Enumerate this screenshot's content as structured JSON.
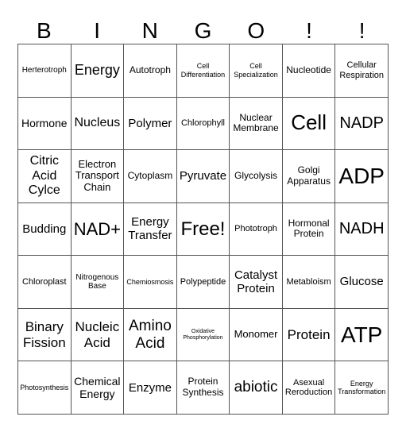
{
  "header": [
    "B",
    "I",
    "N",
    "G",
    "O",
    "!",
    "!"
  ],
  "rows": [
    [
      "Herterotroph",
      "Energy",
      "Autotroph",
      "Cell Differentiation",
      "Cell Specialization",
      "Nucleotide",
      "Cellular Respiration"
    ],
    [
      "Hormone",
      "Nucleus",
      "Polymer",
      "Chlorophyll",
      "Nuclear Membrane",
      "Cell",
      "NADP"
    ],
    [
      "Citric Acid Cylce",
      "Electron Transport Chain",
      "Cytoplasm",
      "Pyruvate",
      "Glycolysis",
      "Golgi Apparatus",
      "ADP"
    ],
    [
      "Budding",
      "NAD+",
      "Energy Transfer",
      "Free!",
      "Phototroph",
      "Hormonal Protein",
      "NADH"
    ],
    [
      "Chloroplast",
      "Nitrogenous Base",
      "Chemiosmosis",
      "Polypeptide",
      "Catalyst Protein",
      "Metabloism",
      "Glucose"
    ],
    [
      "Binary Fission",
      "Nucleic Acid",
      "Amino Acid",
      "Oxidative Phosphorylation",
      "Monomer",
      "Protein",
      "ATP"
    ],
    [
      "Photosynthesis",
      "Chemical Energy",
      "Enzyme",
      "Protein Synthesis",
      "abiotic",
      "Asexual Reroduction",
      "Energy Transformation"
    ]
  ]
}
